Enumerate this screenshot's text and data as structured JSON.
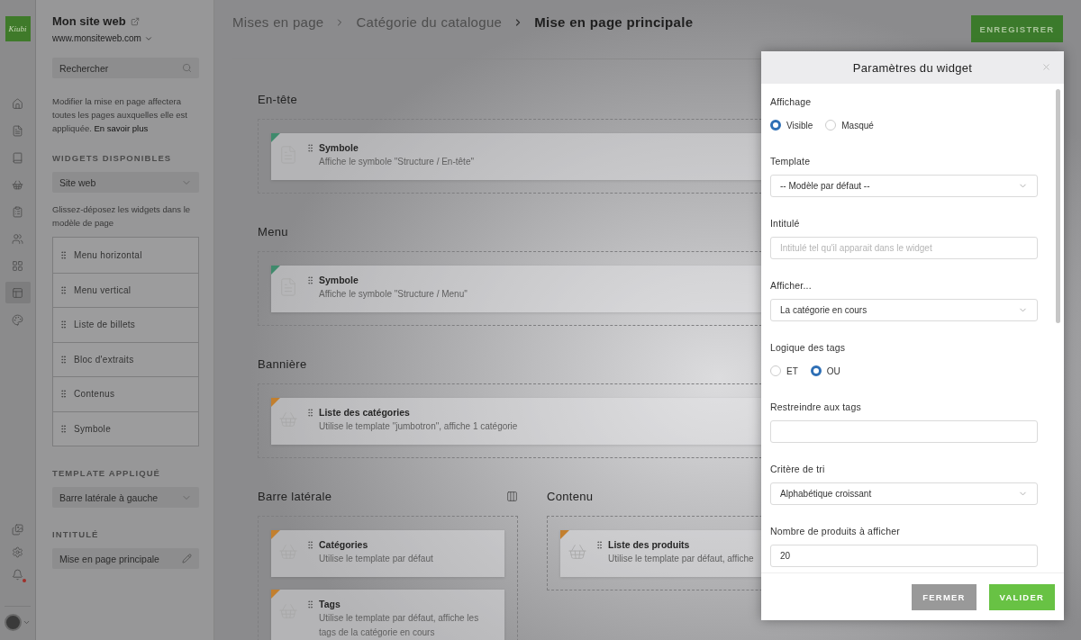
{
  "logo": {
    "text": "Kiubi"
  },
  "nav_rail": {
    "items": [
      {
        "kind": "home",
        "selected": false
      },
      {
        "kind": "page",
        "selected": false
      },
      {
        "kind": "book",
        "selected": false
      },
      {
        "kind": "basket",
        "selected": false
      },
      {
        "kind": "clipboard",
        "selected": false
      },
      {
        "kind": "users",
        "selected": false
      },
      {
        "kind": "widgets",
        "selected": false
      },
      {
        "kind": "layout",
        "selected": true
      },
      {
        "kind": "palette",
        "selected": false
      }
    ],
    "bottom_items": [
      {
        "kind": "media"
      },
      {
        "kind": "settings"
      },
      {
        "kind": "bell",
        "unread": true
      }
    ]
  },
  "sidebar": {
    "site_name": "Mon site web",
    "site_url": "www.monsiteweb.com",
    "search": {
      "placeholder": "Rechercher"
    },
    "notice": "Modifier la mise en page affectera toutes les pages auxquelles elle est appliquée.",
    "notice_link": "En savoir plus",
    "widgets_heading": "WIDGETS DISPONIBLES",
    "widgets_filter": "Site web",
    "widgets_hint": "Glissez-déposez les widgets dans le modèle de page",
    "widgets": [
      "Menu horizontal",
      "Menu vertical",
      "Liste de billets",
      "Bloc d'extraits",
      "Contenus",
      "Symbole"
    ],
    "template_heading": "TEMPLATE APPLIQUÉ",
    "template_value": "Barre latérale à gauche",
    "title_heading": "INTITULÉ",
    "title_value": "Mise en page principale"
  },
  "breadcrumb": [
    {
      "label": "Mises en page",
      "current": false
    },
    {
      "label": "Catégorie du catalogue",
      "current": false
    },
    {
      "label": "Mise en page principale",
      "current": true
    }
  ],
  "save_button": "ENREGISTRER",
  "zones": [
    {
      "title": "En-tête",
      "kind": "full",
      "layout_icon": false,
      "widgets": [
        {
          "kind": "document",
          "color": "#3f8a6c",
          "title": "Symbole",
          "subtitle": "Affiche le symbole \"Structure / En-tête\""
        }
      ]
    },
    {
      "title": "Menu",
      "kind": "full",
      "layout_icon": false,
      "widgets": [
        {
          "kind": "document",
          "color": "#3f8a6c",
          "title": "Symbole",
          "subtitle": "Affiche le symbole \"Structure / Menu\""
        }
      ]
    },
    {
      "title": "Bannière",
      "kind": "full",
      "layout_icon": false,
      "widgets": [
        {
          "kind": "basket",
          "color": "#c27f2e",
          "title": "Liste des catégories",
          "subtitle": "Utilise le template \"jumbotron\", affiche 1 catégorie"
        }
      ]
    },
    {
      "title": "Barre latérale",
      "kind": "column",
      "layout_icon": true,
      "widgets": [
        {
          "kind": "basket",
          "color": "#c27f2e",
          "title": "Catégories",
          "subtitle": "Utilise le template par défaut"
        },
        {
          "kind": "basket",
          "color": "#c27f2e",
          "title": "Tags",
          "subtitle": "Utilise le template par défaut, affiche les tags de la catégorie en cours"
        }
      ]
    },
    {
      "title": "Contenu",
      "kind": "column",
      "layout_icon": false,
      "widgets": [
        {
          "kind": "basket",
          "color": "#c27f2e",
          "title": "Liste des produits",
          "subtitle": "Utilise le template par défaut, affiche"
        }
      ]
    }
  ],
  "modal": {
    "title": "Paramètres du widget",
    "fields": [
      {
        "kind": "radio",
        "label": "Affichage",
        "options": [
          {
            "label": "Visible",
            "selected": true
          },
          {
            "label": "Masqué",
            "selected": false
          }
        ]
      },
      {
        "kind": "select",
        "label": "Template",
        "value": "-- Modèle par défaut --"
      },
      {
        "kind": "text",
        "label": "Intitulé",
        "placeholder": "Intitulé tel qu'il apparait dans le widget"
      },
      {
        "kind": "select",
        "label": "Afficher...",
        "value": "La catégorie en cours"
      },
      {
        "kind": "radio",
        "label": "Logique des tags",
        "options": [
          {
            "label": "ET",
            "selected": false
          },
          {
            "label": "OU",
            "selected": true
          }
        ]
      },
      {
        "kind": "text",
        "label": "Restreindre aux tags"
      },
      {
        "kind": "select",
        "label": "Critère de tri",
        "value": "Alphabétique croissant"
      },
      {
        "kind": "text",
        "label": "Nombre de produits à afficher",
        "value": "20"
      }
    ],
    "buttons": [
      {
        "kind": "secondary",
        "label": "FERMER"
      },
      {
        "kind": "primary",
        "label": "VALIDER"
      }
    ]
  }
}
